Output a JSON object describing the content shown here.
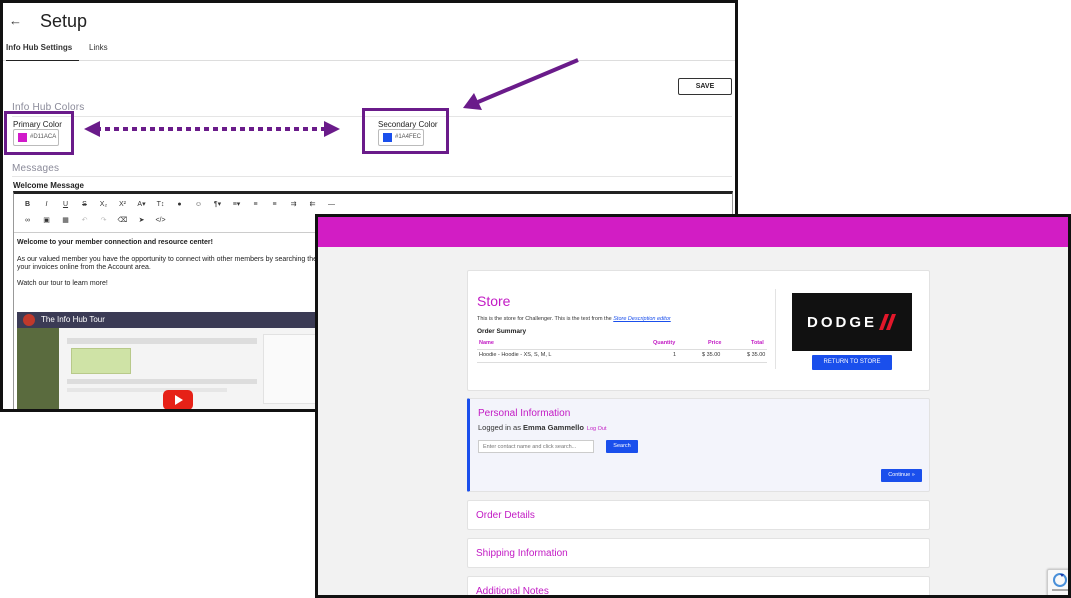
{
  "setup": {
    "back_icon": "arrow-left-icon",
    "title": "Setup",
    "tabs": [
      {
        "label": "Info Hub Settings"
      },
      {
        "label": "Links"
      }
    ],
    "save_label": "SAVE",
    "colors_section": "Info Hub Colors",
    "primary_label": "Primary Color",
    "primary_hex": "#D11ACA",
    "primary_color": "#d11aca",
    "secondary_label": "Secondary Color",
    "secondary_hex": "#1A4FEC",
    "secondary_color": "#1a4fec",
    "messages_section": "Messages",
    "welcome_label": "Welcome Message",
    "editor_lines": [
      "Welcome to your member connection and resource center!",
      "As our valued member you have the opportunity to connect with other members by searching the",
      "your invoices online from the Account area.",
      "Watch our tour to learn more!"
    ],
    "video_title": "The Info Hub Tour"
  },
  "store": {
    "title": "Store",
    "description_prefix": "This is the store for Challenger. This is the text from the",
    "description_link": "Store Description editor",
    "order_summary": "Order Summary",
    "columns": [
      "Name",
      "Quantity",
      "Price",
      "Total"
    ],
    "rows": [
      {
        "name": "Hoodie - Hoodie - XS, S, M, L",
        "quantity": "1",
        "price": "$ 35.00",
        "total": "$ 35.00"
      }
    ],
    "logo_text": "DODGE",
    "return_label": "RETURN TO STORE",
    "personal_title": "Personal Information",
    "logged_in_prefix": "Logged in as",
    "logged_in_name": "Emma Gammello",
    "logout_label": "Log Out",
    "contact_placeholder": "Enter contact name and click search...",
    "search_label": "Search",
    "continue_label": "Continue »",
    "order_details": "Order Details",
    "shipping_info": "Shipping Information",
    "additional_notes": "Additional Notes",
    "brand_bar_color": "#d21dc4"
  },
  "annotation_color": "#6a1b8a"
}
